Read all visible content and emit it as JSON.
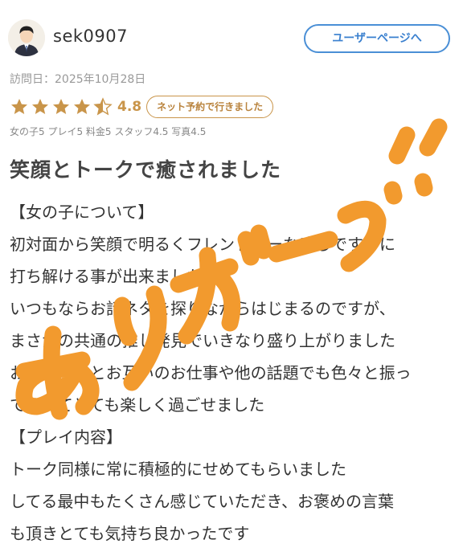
{
  "header": {
    "username": "sek0907",
    "user_page_button": "ユーザーページへ"
  },
  "visit_date": "訪問日：2025年10月28日",
  "rating": {
    "value": "4.8",
    "stars_filled": 4.5,
    "stars_total": 5,
    "star_color": "#c9954a",
    "booking_badge": "ネット予約で行きました"
  },
  "sub_scores": "女の子5 プレイ5 料金5 スタッフ4.5 写真4.5",
  "review": {
    "title": "笑顔とトークで癒されました",
    "lines": [
      "【女の子について】",
      "初対面から笑顔で明るくフレンドリーな感じですぐに",
      "打ち解ける事が出来ました",
      "いつもならお話ネタを探りながらはじまるのですが、",
      "まさかの共通の推し発見でいきなり盛り上がりました",
      "お話しするとお互いのお仕事や他の話題でも色々と振っ",
      "てくれてとても楽しく過ごせました",
      "【プレイ内容】",
      "トーク同様に常に積極的にせめてもらいました",
      "してる最中もたくさん感じていただき、お褒めの言葉",
      "も頂きとても気持ち良かったです"
    ]
  },
  "overlay": {
    "handwritten_text": "ありがとーっ!!",
    "color": "#f29a2e"
  }
}
